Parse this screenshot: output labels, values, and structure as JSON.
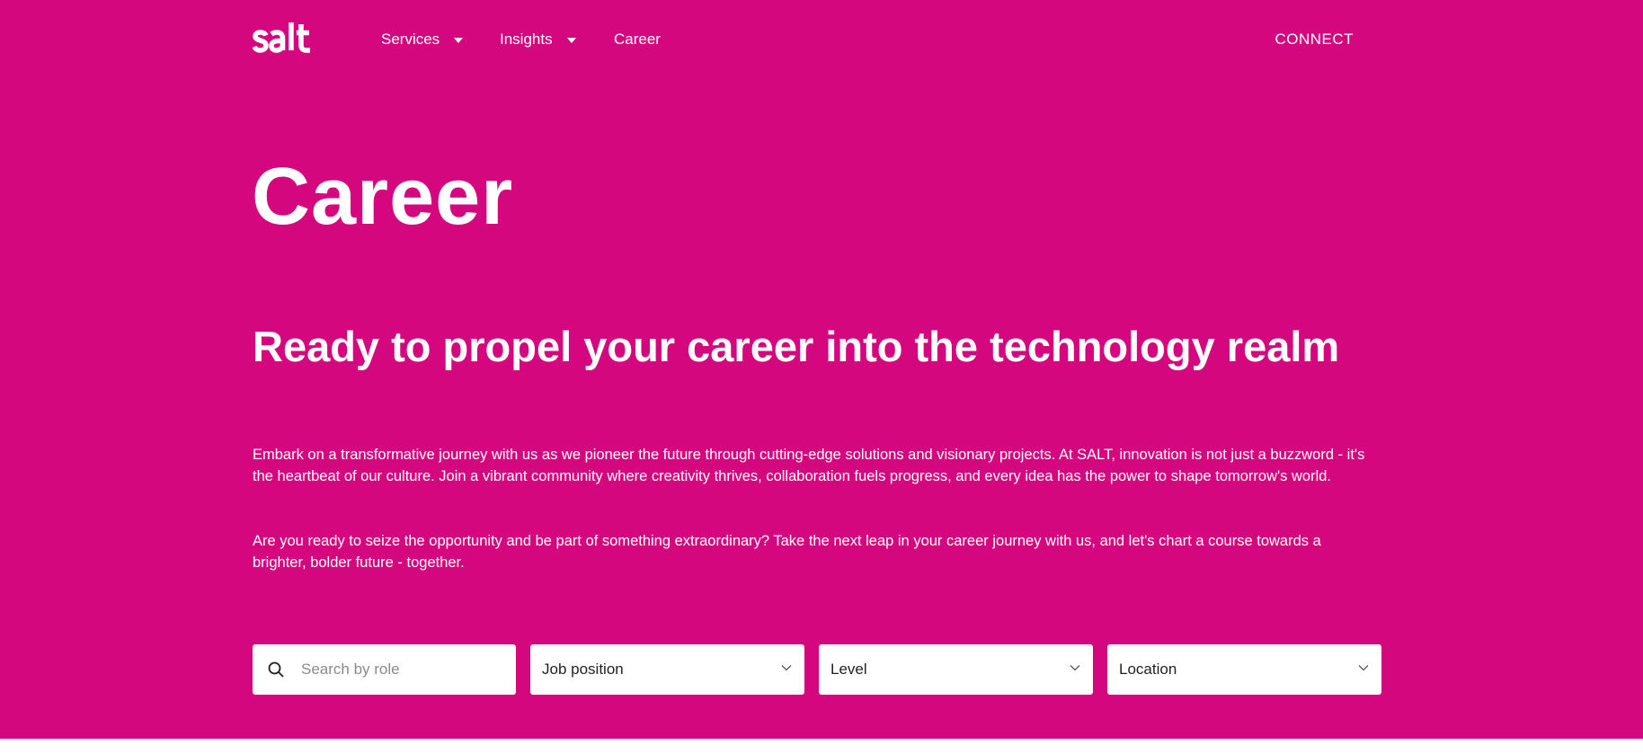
{
  "brand": {
    "logo_text": "salt",
    "primary_color": "#d4077f"
  },
  "nav": {
    "items": [
      {
        "label": "Services",
        "has_dropdown": true
      },
      {
        "label": "Insights",
        "has_dropdown": true
      },
      {
        "label": "Career",
        "has_dropdown": false
      }
    ],
    "cta_label": "CONNECT"
  },
  "page": {
    "title": "Career",
    "headline": "Ready to propel your career into the technology realm",
    "paragraphs": [
      "Embark on a transformative journey with us as we pioneer the future through cutting-edge solutions and visionary projects. At SALT, innovation is not just a buzzword - it's the heartbeat of our culture. Join a vibrant community where creativity thrives, collaboration fuels progress, and every idea has the power to shape tomorrow's world.",
      "Are you ready to seize the opportunity and be part of something extraordinary? Take the next leap in your career journey with us, and let's chart a course towards a brighter, bolder future - together."
    ]
  },
  "filters": {
    "search": {
      "placeholder": "Search by role",
      "value": "",
      "icon": "search-icon"
    },
    "job_position": {
      "label": "Job position",
      "icon": "chevron-down-icon"
    },
    "level": {
      "label": "Level",
      "icon": "chevron-down-icon"
    },
    "location": {
      "label": "Location",
      "icon": "chevron-down-icon"
    }
  }
}
